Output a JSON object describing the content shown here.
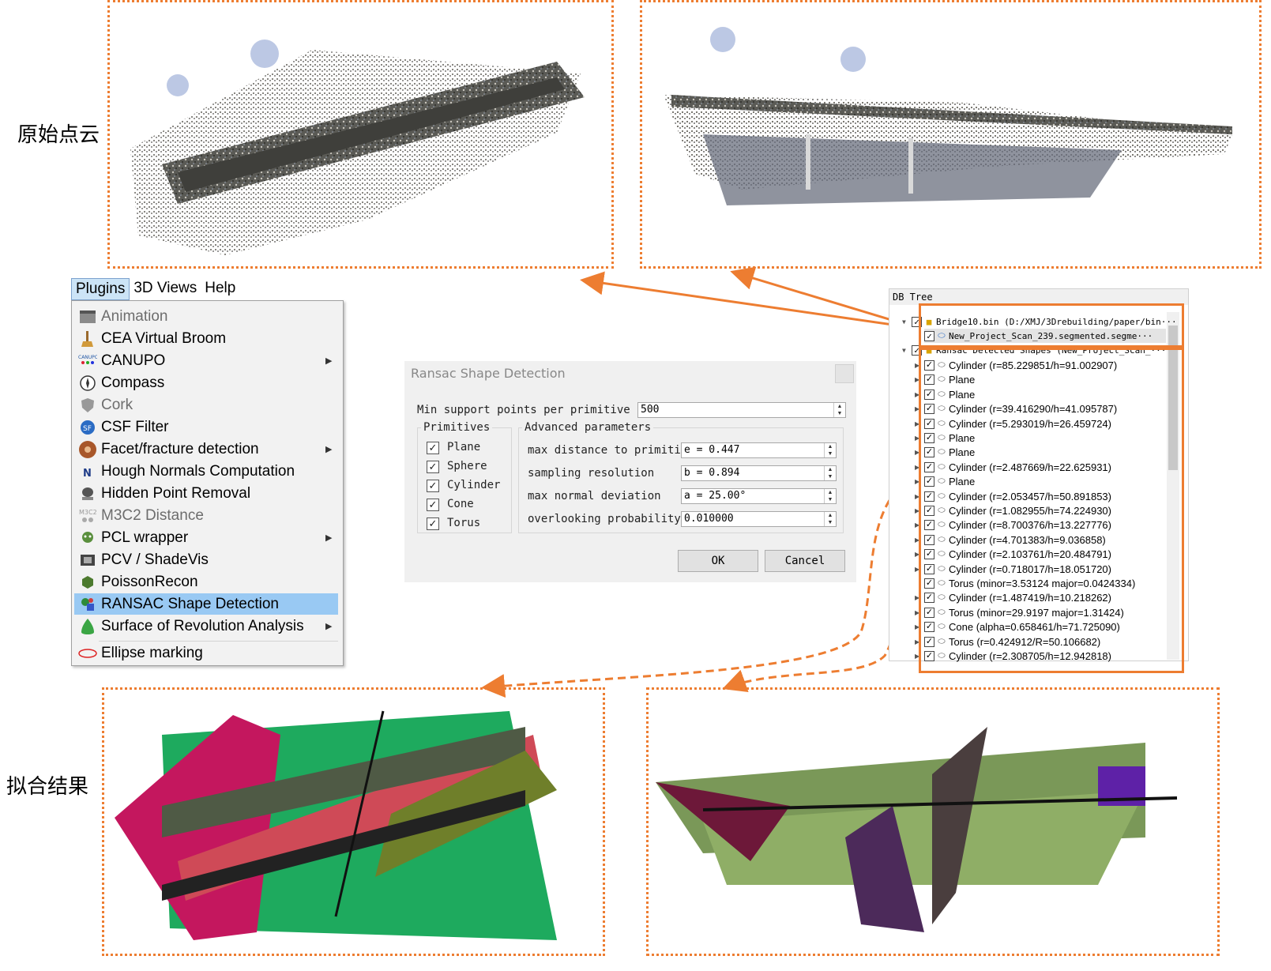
{
  "labels": {
    "original": "原始点云",
    "result": "拟合结果"
  },
  "menubar": {
    "items": [
      "Plugins",
      "3D Views",
      "Help"
    ],
    "active": "Plugins"
  },
  "plugins_menu": {
    "items": [
      {
        "label": "Animation",
        "icon": "animation-icon",
        "disabled": true,
        "submenu": false
      },
      {
        "label": "CEA Virtual Broom",
        "icon": "broom-icon",
        "disabled": false,
        "submenu": false
      },
      {
        "label": "CANUPO",
        "icon": "canupo-icon",
        "disabled": false,
        "submenu": true
      },
      {
        "label": "Compass",
        "icon": "compass-icon",
        "disabled": false,
        "submenu": false
      },
      {
        "label": "Cork",
        "icon": "cork-icon",
        "disabled": true,
        "submenu": false
      },
      {
        "label": "CSF Filter",
        "icon": "csf-icon",
        "disabled": false,
        "submenu": false
      },
      {
        "label": "Facet/fracture detection",
        "icon": "facet-icon",
        "disabled": false,
        "submenu": true
      },
      {
        "label": "Hough Normals Computation",
        "icon": "normals-icon",
        "disabled": false,
        "submenu": false
      },
      {
        "label": "Hidden Point Removal",
        "icon": "hpr-icon",
        "disabled": false,
        "submenu": false
      },
      {
        "label": "M3C2 Distance",
        "icon": "m3c2-icon",
        "disabled": true,
        "submenu": false
      },
      {
        "label": "PCL wrapper",
        "icon": "pcl-icon",
        "disabled": false,
        "submenu": true
      },
      {
        "label": "PCV / ShadeVis",
        "icon": "pcv-icon",
        "disabled": false,
        "submenu": false
      },
      {
        "label": "PoissonRecon",
        "icon": "poisson-icon",
        "disabled": false,
        "submenu": false
      },
      {
        "label": "RANSAC Shape Detection",
        "icon": "ransac-icon",
        "disabled": false,
        "submenu": false,
        "selected": true
      },
      {
        "label": "Surface of Revolution Analysis",
        "icon": "revolution-icon",
        "disabled": false,
        "submenu": true
      },
      {
        "label": "Ellipse marking",
        "icon": "ellipse-icon",
        "disabled": false,
        "submenu": false
      }
    ]
  },
  "ransac_dialog": {
    "title": "Ransac Shape Detection",
    "min_support_label": "Min support points per primitive",
    "min_support_value": "500",
    "primitives_title": "Primitives",
    "primitives": [
      "Plane",
      "Sphere",
      "Cylinder",
      "Cone",
      "Torus"
    ],
    "advanced_title": "Advanced parameters",
    "params": [
      {
        "label": "max distance to primitive",
        "value": "e = 0.447"
      },
      {
        "label": "sampling resolution",
        "value": "b = 0.894"
      },
      {
        "label": "max normal deviation",
        "value": "a = 25.00°"
      },
      {
        "label": "overlooking probability",
        "value": "0.010000"
      }
    ],
    "ok_label": "OK",
    "cancel_label": "Cancel"
  },
  "db_tree": {
    "title": "DB Tree",
    "root": "Bridge10.bin (D:/XMJ/3Drebuilding/paper/bin···",
    "child": "New_Project_Scan_239.segmented.segme···",
    "group": "Ransac Detected Shapes (New_Project_Scan_···",
    "shapes": [
      "Cylinder (r=85.229851/h=91.002907)",
      "Plane",
      "Plane",
      "Cylinder (r=39.416290/h=41.095787)",
      "Cylinder (r=5.293019/h=26.459724)",
      "Plane",
      "Plane",
      "Cylinder (r=2.487669/h=22.625931)",
      "Plane",
      "Cylinder (r=2.053457/h=50.891853)",
      "Cylinder (r=1.082955/h=74.224930)",
      "Cylinder (r=8.700376/h=13.227776)",
      "Cylinder (r=4.701383/h=9.036858)",
      "Cylinder (r=2.103761/h=20.484791)",
      "Cylinder (r=0.718017/h=18.051720)",
      "Torus (minor=3.53124 major=0.0424334)",
      "Cylinder (r=1.487419/h=10.218262)",
      "Torus (minor=29.9197 major=1.31424)",
      "Cone (alpha=0.658461/h=71.725090)",
      "Torus (r=0.424912/R=50.106682)",
      "Cylinder (r=2.308705/h=12.942818)"
    ]
  },
  "colors": {
    "accent": "#ed7d31",
    "menu_highlight": "#99c9f3"
  }
}
